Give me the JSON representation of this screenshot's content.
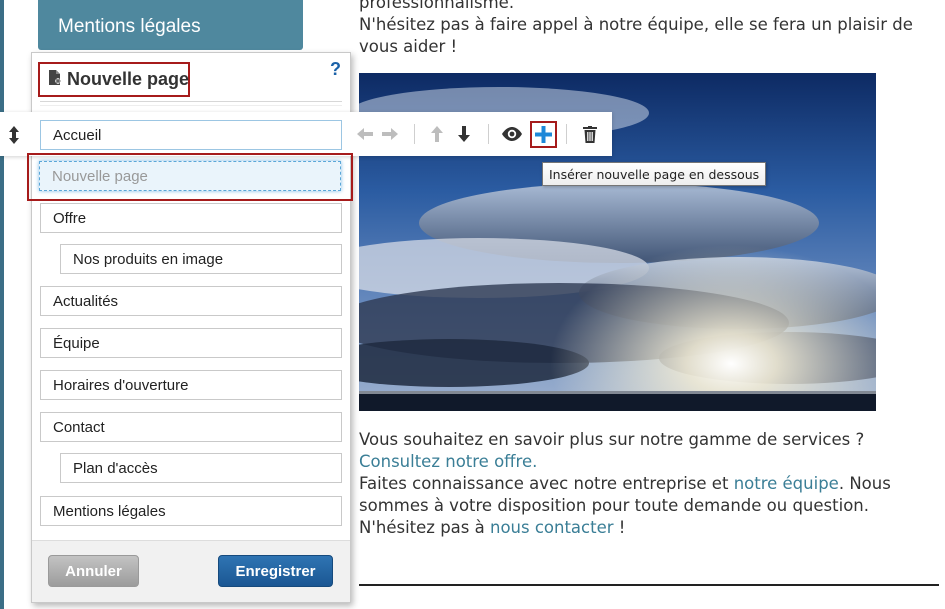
{
  "site_nav": {
    "mentions_label": "Mentions légales"
  },
  "content_top": {
    "line1": "professionnalisme.",
    "line2": "N'hésitez pas à faire appel à notre équipe, elle se fera un plaisir de vous aider !"
  },
  "content_bottom": {
    "question": "Vous souhaitez en savoir plus sur notre gamme de services ?",
    "offer_link": "Consultez notre offre.",
    "p2_before": "Faites connaissance avec notre entreprise et ",
    "team_link": "notre équipe",
    "p2_after": ". Nous sommes à votre disposition pour toute demande ou question.",
    "p3_before": "N'hésitez pas à ",
    "contact_link": "nous contacter",
    "p3_after": " !"
  },
  "panel": {
    "title": "Nouvelle page",
    "help": "?",
    "accueil_value": "Accueil",
    "new_page_placeholder": "Nouvelle page",
    "pages": [
      {
        "label": "Offre"
      },
      {
        "label": "Nos produits en image"
      },
      {
        "label": "Actualités"
      },
      {
        "label": "Équipe"
      },
      {
        "label": "Horaires d'ouverture"
      },
      {
        "label": "Contact"
      },
      {
        "label": "Plan d'accès"
      },
      {
        "label": "Mentions légales"
      }
    ],
    "cancel_label": "Annuler",
    "save_label": "Enregistrer"
  },
  "toolbar": {
    "drag_icon": "updown-arrows-icon",
    "tools": [
      "arrow-left-icon",
      "arrow-right-icon",
      "arrow-up-icon",
      "arrow-down-icon",
      "eye-icon",
      "plus-icon",
      "trash-icon"
    ],
    "tooltip": "Insérer nouvelle page en dessous"
  },
  "colors": {
    "nav_bg": "#4f889e",
    "accent_red": "#a61b1b",
    "save_blue": "#1b5793",
    "link": "#3a7e96",
    "plus_blue": "#1e88d8"
  }
}
